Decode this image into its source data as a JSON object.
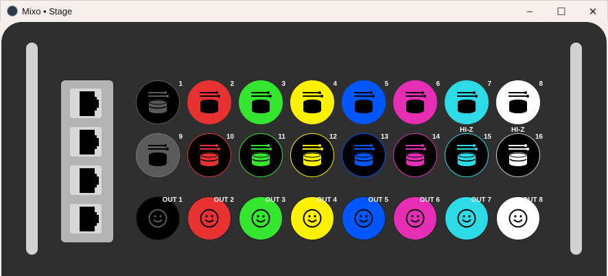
{
  "window": {
    "title": "Mixo • Stage",
    "buttons": [
      "minimize",
      "maximize",
      "close"
    ]
  },
  "ethernet_ports": 4,
  "inputs": [
    {
      "label": "1",
      "bg": "#000000",
      "fg": "#5a5a5a",
      "border": "#5a5a5a"
    },
    {
      "label": "2",
      "bg": "#e83232",
      "fg": "#000000",
      "border": "#e83232"
    },
    {
      "label": "3",
      "bg": "#35e62e",
      "fg": "#000000",
      "border": "#35e62e"
    },
    {
      "label": "4",
      "bg": "#fff200",
      "fg": "#000000",
      "border": "#fff200"
    },
    {
      "label": "5",
      "bg": "#0056ff",
      "fg": "#000000",
      "border": "#0056ff"
    },
    {
      "label": "6",
      "bg": "#e62eb4",
      "fg": "#000000",
      "border": "#e62eb4"
    },
    {
      "label": "7",
      "bg": "#2ddbe6",
      "fg": "#000000",
      "border": "#2ddbe6"
    },
    {
      "label": "8",
      "bg": "#ffffff",
      "fg": "#000000",
      "border": "#ffffff"
    },
    {
      "label": "9",
      "bg": "#5a5a5a",
      "fg": "#000000",
      "border": "#777777"
    },
    {
      "label": "10",
      "bg": "#000000",
      "fg": "#e83232",
      "border": "#e83232"
    },
    {
      "label": "11",
      "bg": "#000000",
      "fg": "#35e62e",
      "border": "#35e62e"
    },
    {
      "label": "12",
      "bg": "#000000",
      "fg": "#fff200",
      "border": "#fff200"
    },
    {
      "label": "13",
      "bg": "#000000",
      "fg": "#0056ff",
      "border": "#0056ff"
    },
    {
      "label": "14",
      "bg": "#000000",
      "fg": "#e62eb4",
      "border": "#e62eb4"
    },
    {
      "label": "15",
      "bg": "#000000",
      "fg": "#2ddbe6",
      "border": "#2ddbe6",
      "tag": "HI-Z"
    },
    {
      "label": "16",
      "bg": "#000000",
      "fg": "#ffffff",
      "border": "#cccccc",
      "tag": "HI-Z"
    }
  ],
  "outputs": [
    {
      "label": "OUT 1",
      "bg": "#000000",
      "fg": "#5a5a5a"
    },
    {
      "label": "OUT 2",
      "bg": "#e83232",
      "fg": "#000000"
    },
    {
      "label": "OUT 3",
      "bg": "#35e62e",
      "fg": "#000000"
    },
    {
      "label": "OUT 4",
      "bg": "#fff200",
      "fg": "#000000"
    },
    {
      "label": "OUT 5",
      "bg": "#0056ff",
      "fg": "#000000"
    },
    {
      "label": "OUT 6",
      "bg": "#e62eb4",
      "fg": "#000000"
    },
    {
      "label": "OUT 7",
      "bg": "#2ddbe6",
      "fg": "#000000"
    },
    {
      "label": "OUT 8",
      "bg": "#ffffff",
      "fg": "#000000"
    }
  ]
}
